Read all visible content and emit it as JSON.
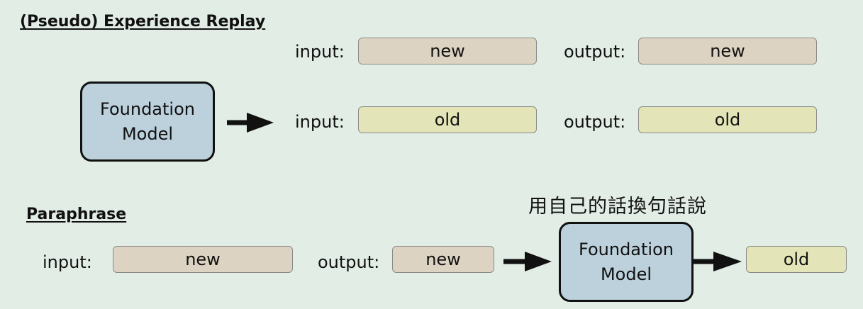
{
  "experience_replay": {
    "heading": "(Pseudo) Experience Replay",
    "model": {
      "line1": "Foundation",
      "line2": "Model"
    },
    "rows": [
      {
        "input_label": "input:",
        "input_value": "new",
        "output_label": "output:",
        "output_value": "new"
      },
      {
        "input_label": "input:",
        "input_value": "old",
        "output_label": "output:",
        "output_value": "old"
      }
    ]
  },
  "paraphrase": {
    "heading": "Paraphrase",
    "caption": "用自己的話換句話說",
    "input_label": "input:",
    "input_value": "new",
    "output_label": "output:",
    "output_value": "new",
    "model": {
      "line1": "Foundation",
      "line2": "Model"
    },
    "result_value": "old"
  },
  "colors": {
    "background": "#e2ede6",
    "new_fill": "#ddd3c2",
    "old_fill": "#e3e5b8",
    "model_fill": "#bcd1dc"
  }
}
